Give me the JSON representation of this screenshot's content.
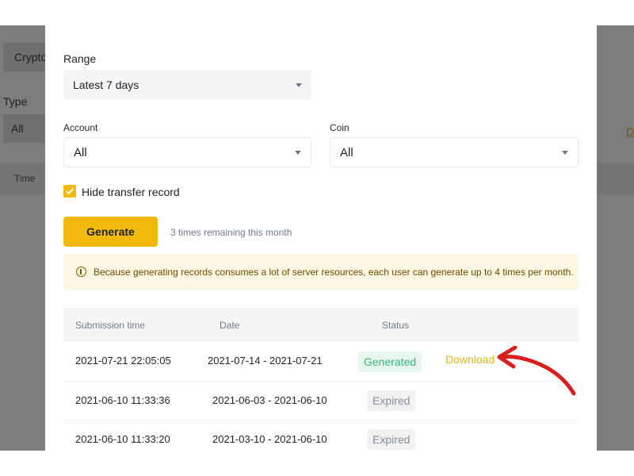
{
  "background": {
    "crypto_label": "Crypto",
    "type_label": "Type",
    "type_value": "All",
    "time_header": "Time",
    "right_link": "D"
  },
  "range": {
    "label": "Range",
    "value": "Latest 7 days"
  },
  "account": {
    "label": "Account",
    "value": "All"
  },
  "coin": {
    "label": "Coin",
    "value": "All"
  },
  "hide_transfer": {
    "label": "Hide transfer record",
    "checked": true
  },
  "generate": {
    "button_label": "Generate",
    "remaining_text": "3 times remaining this month"
  },
  "notice": {
    "icon": "info-icon",
    "text": "Because generating records consumes a lot of server resources, each user can generate up to 4 times per month."
  },
  "table": {
    "headers": {
      "submission_time": "Submission time",
      "date": "Date",
      "status": "Status"
    },
    "rows": [
      {
        "submission_time": "2021-07-21 22:05:05",
        "date": "2021-07-14 - 2021-07-21",
        "status": "Generated",
        "action": "Download"
      },
      {
        "submission_time": "2021-06-10 11:33:36",
        "date": "2021-06-03 - 2021-06-10",
        "status": "Expired",
        "action": ""
      },
      {
        "submission_time": "2021-06-10 11:33:20",
        "date": "2021-03-10 - 2021-06-10",
        "status": "Expired",
        "action": ""
      }
    ]
  },
  "colors": {
    "accent": "#f0b90b",
    "annotation_arrow": "#d81e1e",
    "generated": "#35b877",
    "expired": "#848e9c"
  }
}
